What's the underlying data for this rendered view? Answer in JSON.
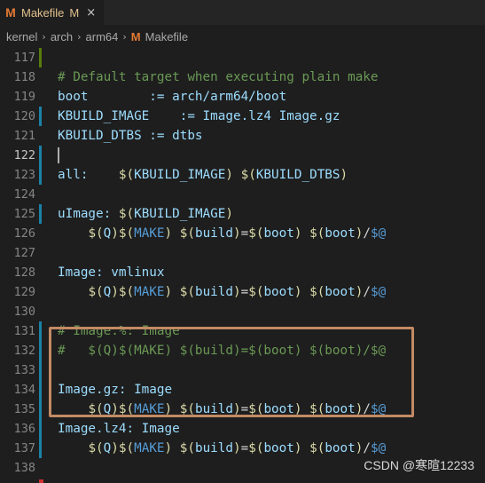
{
  "tab": {
    "icon": "M",
    "name": "Makefile",
    "modified": "M",
    "close": "×"
  },
  "breadcrumb": {
    "items": [
      "kernel",
      "arch",
      "arm64"
    ],
    "file_icon": "M",
    "file": "Makefile"
  },
  "watermark": "CSDN @寒暄12233",
  "colors": {
    "accent": "#e37933",
    "box": "#c38a64",
    "gutter_modified": "#1b81a8",
    "gutter_added": "#587c0c"
  },
  "lines": [
    {
      "n": "117",
      "gutter": "added",
      "tokens": []
    },
    {
      "n": "118",
      "tokens": [
        {
          "t": "# Default target when executing plain make",
          "c": "comment"
        }
      ]
    },
    {
      "n": "119",
      "tokens": [
        {
          "t": "boot        := arch/arm64/boot",
          "c": "var"
        }
      ]
    },
    {
      "n": "120",
      "gutter": "modified",
      "tokens": [
        {
          "t": "KBUILD_IMAGE    := Image.lz4 Image.gz",
          "c": "var"
        }
      ]
    },
    {
      "n": "121",
      "tokens": [
        {
          "t": "KBUILD_DTBS := dtbs",
          "c": "var"
        }
      ]
    },
    {
      "n": "122",
      "gutter": "modified",
      "current": true,
      "tokens": []
    },
    {
      "n": "123",
      "gutter": "modified",
      "tokens": [
        {
          "t": "all:    ",
          "c": "var"
        },
        {
          "t": "$(",
          "c": "dollar"
        },
        {
          "t": "KBUILD_IMAGE",
          "c": "var"
        },
        {
          "t": ") ",
          "c": "dollar"
        },
        {
          "t": "$(",
          "c": "dollar"
        },
        {
          "t": "KBUILD_DTBS",
          "c": "var"
        },
        {
          "t": ")",
          "c": "dollar"
        }
      ]
    },
    {
      "n": "124",
      "tokens": []
    },
    {
      "n": "125",
      "gutter": "modified",
      "tokens": [
        {
          "t": "uImage: ",
          "c": "var"
        },
        {
          "t": "$(",
          "c": "dollar"
        },
        {
          "t": "KBUILD_IMAGE",
          "c": "var"
        },
        {
          "t": ")",
          "c": "dollar"
        }
      ]
    },
    {
      "n": "126",
      "tokens": [
        {
          "t": "    ",
          "c": "text"
        },
        {
          "t": "$(",
          "c": "dollar"
        },
        {
          "t": "Q",
          "c": "var"
        },
        {
          "t": ")",
          "c": "dollar"
        },
        {
          "t": "$(",
          "c": "dollar"
        },
        {
          "t": "MAKE",
          "c": "macro"
        },
        {
          "t": ") ",
          "c": "dollar"
        },
        {
          "t": "$(",
          "c": "dollar"
        },
        {
          "t": "build",
          "c": "var"
        },
        {
          "t": ")",
          "c": "dollar"
        },
        {
          "t": "=",
          "c": "text"
        },
        {
          "t": "$(",
          "c": "dollar"
        },
        {
          "t": "boot",
          "c": "var"
        },
        {
          "t": ") ",
          "c": "dollar"
        },
        {
          "t": "$(",
          "c": "dollar"
        },
        {
          "t": "boot",
          "c": "var"
        },
        {
          "t": ")",
          "c": "dollar"
        },
        {
          "t": "/",
          "c": "text"
        },
        {
          "t": "$@",
          "c": "macro"
        }
      ]
    },
    {
      "n": "127",
      "tokens": []
    },
    {
      "n": "128",
      "tokens": [
        {
          "t": "Image: vmlinux",
          "c": "var"
        }
      ]
    },
    {
      "n": "129",
      "tokens": [
        {
          "t": "    ",
          "c": "text"
        },
        {
          "t": "$(",
          "c": "dollar"
        },
        {
          "t": "Q",
          "c": "var"
        },
        {
          "t": ")",
          "c": "dollar"
        },
        {
          "t": "$(",
          "c": "dollar"
        },
        {
          "t": "MAKE",
          "c": "macro"
        },
        {
          "t": ") ",
          "c": "dollar"
        },
        {
          "t": "$(",
          "c": "dollar"
        },
        {
          "t": "build",
          "c": "var"
        },
        {
          "t": ")",
          "c": "dollar"
        },
        {
          "t": "=",
          "c": "text"
        },
        {
          "t": "$(",
          "c": "dollar"
        },
        {
          "t": "boot",
          "c": "var"
        },
        {
          "t": ") ",
          "c": "dollar"
        },
        {
          "t": "$(",
          "c": "dollar"
        },
        {
          "t": "boot",
          "c": "var"
        },
        {
          "t": ")",
          "c": "dollar"
        },
        {
          "t": "/",
          "c": "text"
        },
        {
          "t": "$@",
          "c": "macro"
        }
      ]
    },
    {
      "n": "130",
      "tokens": []
    },
    {
      "n": "131",
      "gutter": "modified",
      "tokens": [
        {
          "t": "# Image.%: Image",
          "c": "comment"
        }
      ]
    },
    {
      "n": "132",
      "gutter": "modified",
      "tokens": [
        {
          "t": "#   $(Q)$(MAKE) $(build)=$(boot) $(boot)/$@",
          "c": "comment"
        }
      ]
    },
    {
      "n": "133",
      "gutter": "modified",
      "tokens": []
    },
    {
      "n": "134",
      "gutter": "modified",
      "tokens": [
        {
          "t": "Image.gz: Image",
          "c": "var"
        }
      ]
    },
    {
      "n": "135",
      "gutter": "modified",
      "tokens": [
        {
          "t": "    ",
          "c": "text"
        },
        {
          "t": "$(",
          "c": "dollar"
        },
        {
          "t": "Q",
          "c": "var"
        },
        {
          "t": ")",
          "c": "dollar"
        },
        {
          "t": "$(",
          "c": "dollar"
        },
        {
          "t": "MAKE",
          "c": "macro"
        },
        {
          "t": ") ",
          "c": "dollar"
        },
        {
          "t": "$(",
          "c": "dollar"
        },
        {
          "t": "build",
          "c": "var"
        },
        {
          "t": ")",
          "c": "dollar"
        },
        {
          "t": "=",
          "c": "text"
        },
        {
          "t": "$(",
          "c": "dollar"
        },
        {
          "t": "boot",
          "c": "var"
        },
        {
          "t": ") ",
          "c": "dollar"
        },
        {
          "t": "$(",
          "c": "dollar"
        },
        {
          "t": "boot",
          "c": "var"
        },
        {
          "t": ")",
          "c": "dollar"
        },
        {
          "t": "/",
          "c": "text"
        },
        {
          "t": "$@",
          "c": "macro"
        }
      ]
    },
    {
      "n": "136",
      "gutter": "modified",
      "tokens": [
        {
          "t": "Image.lz4: Image",
          "c": "var"
        }
      ]
    },
    {
      "n": "137",
      "gutter": "modified",
      "tokens": [
        {
          "t": "    ",
          "c": "text"
        },
        {
          "t": "$(",
          "c": "dollar"
        },
        {
          "t": "Q",
          "c": "var"
        },
        {
          "t": ")",
          "c": "dollar"
        },
        {
          "t": "$(",
          "c": "dollar"
        },
        {
          "t": "MAKE",
          "c": "macro"
        },
        {
          "t": ") ",
          "c": "dollar"
        },
        {
          "t": "$(",
          "c": "dollar"
        },
        {
          "t": "build",
          "c": "var"
        },
        {
          "t": ")",
          "c": "dollar"
        },
        {
          "t": "=",
          "c": "text"
        },
        {
          "t": "$(",
          "c": "dollar"
        },
        {
          "t": "boot",
          "c": "var"
        },
        {
          "t": ") ",
          "c": "dollar"
        },
        {
          "t": "$(",
          "c": "dollar"
        },
        {
          "t": "boot",
          "c": "var"
        },
        {
          "t": ")",
          "c": "dollar"
        },
        {
          "t": "/",
          "c": "text"
        },
        {
          "t": "$@",
          "c": "macro"
        }
      ]
    },
    {
      "n": "138",
      "tokens": []
    }
  ]
}
